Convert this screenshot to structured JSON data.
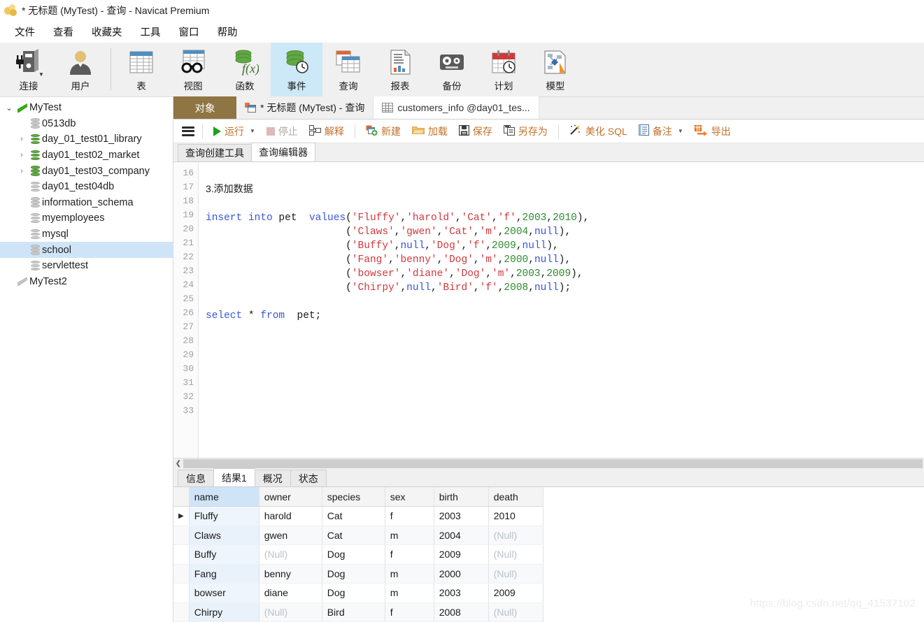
{
  "window": {
    "title": "* 无标题 (MyTest) - 查询 - Navicat Premium",
    "logo_icon": "navicat-logo-icon"
  },
  "menubar": {
    "items": [
      {
        "label": "文件",
        "name": "menu-file"
      },
      {
        "label": "查看",
        "name": "menu-view"
      },
      {
        "label": "收藏夹",
        "name": "menu-favorites"
      },
      {
        "label": "工具",
        "name": "menu-tools"
      },
      {
        "label": "窗口",
        "name": "menu-window"
      },
      {
        "label": "帮助",
        "name": "menu-help"
      }
    ]
  },
  "ribbon": {
    "group1": [
      {
        "label": "连接",
        "icon": "connection-icon",
        "active": false,
        "has_dropdown": true
      },
      {
        "label": "用户",
        "icon": "user-icon",
        "active": false,
        "has_dropdown": false
      }
    ],
    "group2": [
      {
        "label": "表",
        "icon": "table-icon",
        "active": false
      },
      {
        "label": "视图",
        "icon": "view-glasses-icon",
        "active": false
      },
      {
        "label": "函数",
        "icon": "function-icon",
        "active": false
      },
      {
        "label": "事件",
        "icon": "event-clock-icon",
        "active": true
      },
      {
        "label": "查询",
        "icon": "query-icon",
        "active": false
      },
      {
        "label": "报表",
        "icon": "report-icon",
        "active": false
      },
      {
        "label": "备份",
        "icon": "backup-tape-icon",
        "active": false
      },
      {
        "label": "计划",
        "icon": "schedule-calendar-icon",
        "active": false
      },
      {
        "label": "模型",
        "icon": "model-diagram-icon",
        "active": false
      }
    ]
  },
  "sidebar": {
    "nodes": [
      {
        "label": "MyTest",
        "depth": 0,
        "arrow": "open",
        "icon": "connection-flag-green-icon",
        "selected": false
      },
      {
        "label": "0513db",
        "depth": 1,
        "arrow": "none",
        "icon": "database-grey-icon",
        "selected": false
      },
      {
        "label": "day_01_test01_library",
        "depth": 1,
        "arrow": "closed",
        "icon": "database-green-icon",
        "selected": false
      },
      {
        "label": "day01_test02_market",
        "depth": 1,
        "arrow": "closed",
        "icon": "database-green-icon",
        "selected": false
      },
      {
        "label": "day01_test03_company",
        "depth": 1,
        "arrow": "closed",
        "icon": "database-green-icon",
        "selected": false
      },
      {
        "label": "day01_test04db",
        "depth": 1,
        "arrow": "none",
        "icon": "database-grey-icon",
        "selected": false
      },
      {
        "label": "information_schema",
        "depth": 1,
        "arrow": "none",
        "icon": "database-grey-icon",
        "selected": false
      },
      {
        "label": "myemployees",
        "depth": 1,
        "arrow": "none",
        "icon": "database-grey-icon",
        "selected": false
      },
      {
        "label": "mysql",
        "depth": 1,
        "arrow": "none",
        "icon": "database-grey-icon",
        "selected": false
      },
      {
        "label": "school",
        "depth": 1,
        "arrow": "none",
        "icon": "database-grey-icon",
        "selected": true
      },
      {
        "label": "servlettest",
        "depth": 1,
        "arrow": "none",
        "icon": "database-grey-icon",
        "selected": false
      },
      {
        "label": "MyTest2",
        "depth": 0,
        "arrow": "none",
        "icon": "connection-flag-grey-icon",
        "selected": false
      }
    ]
  },
  "tabstrip": {
    "object_button": "对象",
    "tabs": [
      {
        "label": "* 无标题 (MyTest) - 查询",
        "icon": "query-tab-icon",
        "active": true
      },
      {
        "label": "customers_info @day01_tes...",
        "icon": "table-tab-icon",
        "active": false
      }
    ]
  },
  "query_toolbar": {
    "menu_icon": "hamburger-menu-icon",
    "buttons": [
      {
        "label": "运行",
        "icon": "play-run-icon",
        "disabled": false,
        "dropdown": true
      },
      {
        "label": "停止",
        "icon": "stop-square-icon",
        "disabled": true,
        "dropdown": false
      },
      {
        "label": "解释",
        "icon": "explain-icon",
        "disabled": false,
        "dropdown": false
      },
      {
        "label": "新建",
        "icon": "new-query-icon",
        "disabled": false,
        "dropdown": false
      },
      {
        "label": "加载",
        "icon": "open-folder-icon",
        "disabled": false,
        "dropdown": false
      },
      {
        "label": "保存",
        "icon": "save-disk-icon",
        "disabled": false,
        "dropdown": false
      },
      {
        "label": "另存为",
        "icon": "save-as-icon",
        "disabled": false,
        "dropdown": false
      },
      {
        "label": "美化 SQL",
        "icon": "beautify-wand-icon",
        "disabled": false,
        "dropdown": false
      },
      {
        "label": "备注",
        "icon": "comment-doc-icon",
        "disabled": false,
        "dropdown": true
      },
      {
        "label": "导出",
        "icon": "export-arrow-icon",
        "disabled": false,
        "dropdown": false
      }
    ]
  },
  "sub_tabs": [
    {
      "label": "查询创建工具",
      "active": false
    },
    {
      "label": "查询编辑器",
      "active": true
    }
  ],
  "editor": {
    "first_line": 16,
    "last_line": 33,
    "lines": [
      {
        "n": 16,
        "text": ""
      },
      {
        "n": 17,
        "text": "3.添加数据"
      },
      {
        "n": 18,
        "text": ""
      },
      {
        "n": 19,
        "text": "insert into pet  values('Fluffy','harold','Cat','f',2003,2010),"
      },
      {
        "n": 20,
        "text": "                       ('Claws','gwen','Cat','m',2004,null),"
      },
      {
        "n": 21,
        "text": "                       ('Buffy',null,'Dog','f',2009,null),"
      },
      {
        "n": 22,
        "text": "                       ('Fang','benny','Dog','m',2000,null),"
      },
      {
        "n": 23,
        "text": "                       ('bowser','diane','Dog','m',2003,2009),"
      },
      {
        "n": 24,
        "text": "                       ('Chirpy',null,'Bird','f',2008,null);"
      },
      {
        "n": 25,
        "text": ""
      },
      {
        "n": 26,
        "text": "select * from  pet;"
      },
      {
        "n": 27,
        "text": ""
      },
      {
        "n": 28,
        "text": ""
      },
      {
        "n": 29,
        "text": ""
      },
      {
        "n": 30,
        "text": ""
      },
      {
        "n": 31,
        "text": ""
      },
      {
        "n": 32,
        "text": ""
      },
      {
        "n": 33,
        "text": ""
      }
    ]
  },
  "result_tabs": [
    {
      "label": "信息",
      "active": false
    },
    {
      "label": "结果1",
      "active": true
    },
    {
      "label": "概况",
      "active": false
    },
    {
      "label": "状态",
      "active": false
    }
  ],
  "result_grid": {
    "columns": [
      "name",
      "owner",
      "species",
      "sex",
      "birth",
      "death"
    ],
    "selected_column": "name",
    "current_row": 0,
    "null_text": "(Null)",
    "rows": [
      {
        "name": "Fluffy",
        "owner": "harold",
        "species": "Cat",
        "sex": "f",
        "birth": "2003",
        "death": "2010"
      },
      {
        "name": "Claws",
        "owner": "gwen",
        "species": "Cat",
        "sex": "m",
        "birth": "2004",
        "death": "(Null)"
      },
      {
        "name": "Buffy",
        "owner": "(Null)",
        "species": "Dog",
        "sex": "f",
        "birth": "2009",
        "death": "(Null)"
      },
      {
        "name": "Fang",
        "owner": "benny",
        "species": "Dog",
        "sex": "m",
        "birth": "2000",
        "death": "(Null)"
      },
      {
        "name": "bowser",
        "owner": "diane",
        "species": "Dog",
        "sex": "m",
        "birth": "2003",
        "death": "2009"
      },
      {
        "name": "Chirpy",
        "owner": "(Null)",
        "species": "Bird",
        "sex": "f",
        "birth": "2008",
        "death": "(Null)"
      }
    ]
  },
  "watermark": "https://blog.csdn.net/qq_41537102",
  "colors": {
    "ribbon_active": "#cde8f7",
    "object_tab": "#8f7544",
    "toolbar_text": "#c4712a",
    "tree_selected": "#cfe4f7",
    "sql_keyword": "#3a55d9",
    "sql_string": "#d0393e",
    "sql_number": "#2e8b2e",
    "grid_header_selected": "#cfe4f7"
  }
}
